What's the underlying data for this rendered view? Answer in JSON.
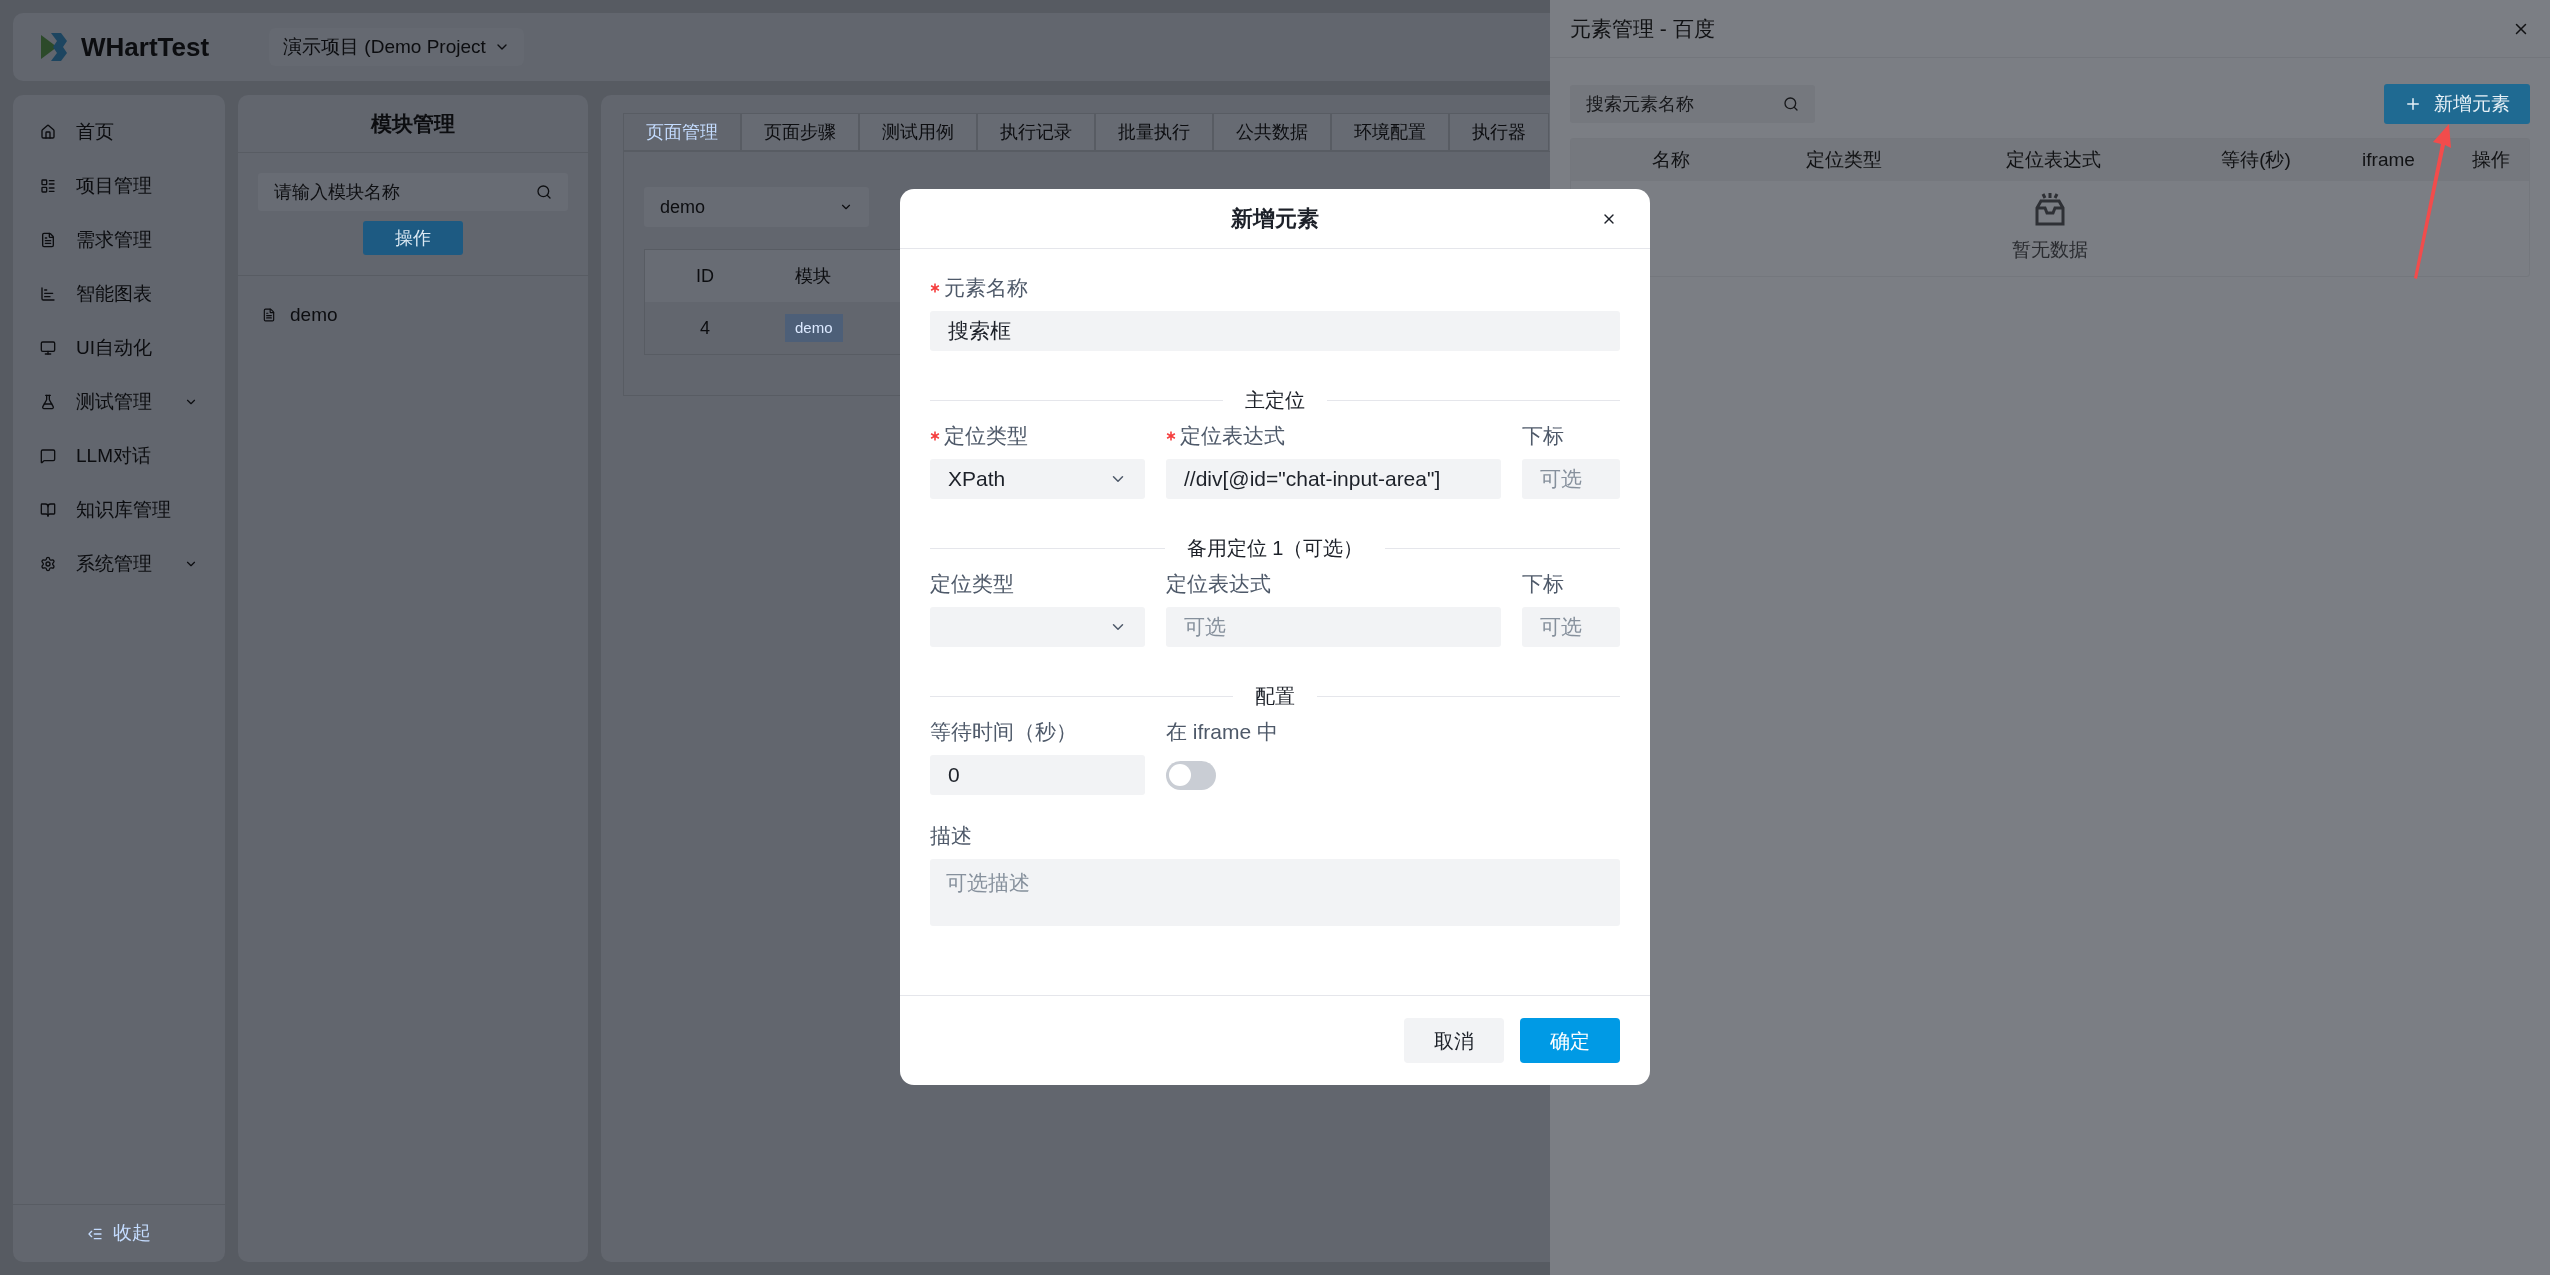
{
  "header": {
    "logo_text": "WHartTest",
    "project_select": "演示项目 (Demo Project"
  },
  "sidebar": {
    "items": [
      {
        "label": "首页",
        "has_submenu": false
      },
      {
        "label": "项目管理",
        "has_submenu": false
      },
      {
        "label": "需求管理",
        "has_submenu": false
      },
      {
        "label": "智能图表",
        "has_submenu": false
      },
      {
        "label": "UI自动化",
        "has_submenu": false
      },
      {
        "label": "测试管理",
        "has_submenu": true
      },
      {
        "label": "LLM对话",
        "has_submenu": false
      },
      {
        "label": "知识库管理",
        "has_submenu": false
      },
      {
        "label": "系统管理",
        "has_submenu": true
      }
    ],
    "collapse": "收起"
  },
  "module_panel": {
    "title": "模块管理",
    "search": {
      "placeholder": "请输入模块名称"
    },
    "action_button": "操作",
    "tree": [
      {
        "label": "demo"
      }
    ]
  },
  "main": {
    "tabs": [
      {
        "label": "页面管理",
        "selected": true
      },
      {
        "label": "页面步骤",
        "selected": false
      },
      {
        "label": "测试用例",
        "selected": false
      },
      {
        "label": "执行记录",
        "selected": false
      },
      {
        "label": "批量执行",
        "selected": false
      },
      {
        "label": "公共数据",
        "selected": false
      },
      {
        "label": "环境配置",
        "selected": false
      },
      {
        "label": "执行器",
        "selected": false
      }
    ],
    "module_select": "demo",
    "table": {
      "columns": [
        "ID",
        "模块"
      ],
      "rows": [
        [
          "4",
          "demo"
        ]
      ]
    }
  },
  "drawer": {
    "title": "元素管理 - 百度",
    "search": {
      "placeholder": "搜索元素名称"
    },
    "add_button": "新增元素",
    "columns": [
      "名称",
      "定位类型",
      "定位表达式",
      "等待(秒)",
      "iframe",
      "操作"
    ],
    "empty_text": "暂无数据"
  },
  "modal": {
    "title": "新增元素",
    "name_field": {
      "label": "元素名称",
      "required": true,
      "value": "搜索框"
    },
    "locators": [
      {
        "title": "主定位",
        "type": {
          "label": "定位类型",
          "required": true,
          "value": "XPath"
        },
        "expression": {
          "label": "定位表达式",
          "required": true,
          "value": "//div[@id=\"chat-input-area\"]"
        },
        "index": {
          "label": "下标",
          "required": false,
          "placeholder": "可选"
        }
      },
      {
        "title": "备用定位 1（可选）",
        "type": {
          "label": "定位类型",
          "required": false
        },
        "expression": {
          "label": "定位表达式",
          "required": false,
          "placeholder": "可选"
        },
        "index": {
          "label": "下标",
          "required": false,
          "placeholder": "可选"
        }
      }
    ],
    "config": {
      "title": "配置",
      "wait": {
        "label": "等待时间（秒）",
        "value": "0"
      },
      "iframe": {
        "label": "在 iframe 中",
        "on": false
      }
    },
    "description": {
      "label": "描述",
      "placeholder": "可选描述"
    },
    "buttons": [
      {
        "label": "取消",
        "kind": "secondary"
      },
      {
        "label": "确定",
        "kind": "primary"
      }
    ]
  }
}
